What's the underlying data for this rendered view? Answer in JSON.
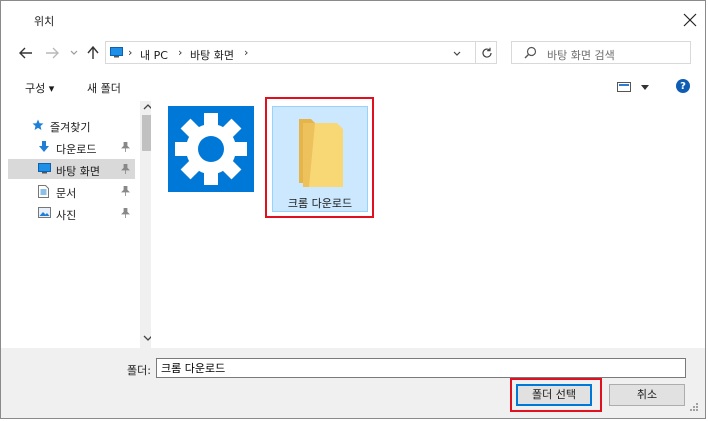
{
  "window": {
    "title": "위치",
    "close_icon": "close-icon"
  },
  "nav": {
    "back_icon": "arrow-left-icon",
    "forward_icon": "arrow-right-icon",
    "dropdown_icon": "chevron-down-icon",
    "up_icon": "arrow-up-icon",
    "breadcrumb": [
      "내 PC",
      "바탕 화면"
    ],
    "refresh_icon": "refresh-icon",
    "search_placeholder": "바탕 화면 검색"
  },
  "toolbar": {
    "organize_label": "구성 ▾",
    "new_folder_label": "새 폴더",
    "help_label": "?"
  },
  "sidebar": {
    "items": [
      {
        "label": "즐겨찾기",
        "icon": "star-icon",
        "pinned": false,
        "selected": false
      },
      {
        "label": "다운로드",
        "icon": "download-icon",
        "pinned": true,
        "selected": false
      },
      {
        "label": "바탕 화면",
        "icon": "desktop-icon",
        "pinned": true,
        "selected": true
      },
      {
        "label": "문서",
        "icon": "document-icon",
        "pinned": true,
        "selected": false
      },
      {
        "label": "사진",
        "icon": "picture-icon",
        "pinned": true,
        "selected": false
      }
    ]
  },
  "content": {
    "items": [
      {
        "label": "",
        "icon": "gear-icon"
      },
      {
        "label": "크롬 다운로드",
        "icon": "folder-icon",
        "selected": true
      }
    ]
  },
  "footer": {
    "folder_label": "폴더:",
    "folder_value": "크롬 다운로드",
    "select_button": "폴더 선택",
    "cancel_button": "취소"
  },
  "colors": {
    "accent": "#0078d7",
    "highlight": "#e0101f",
    "selection": "#cce8ff"
  }
}
